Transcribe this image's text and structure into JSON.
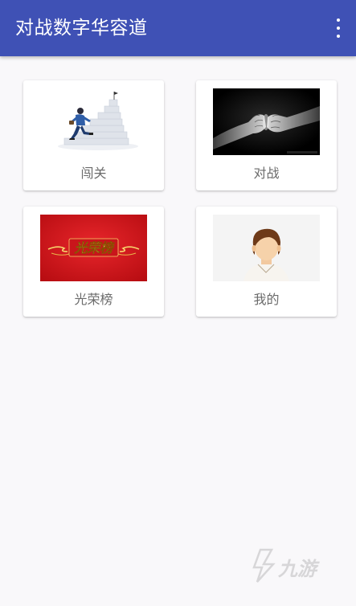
{
  "app_bar": {
    "title": "对战数字华容道",
    "menu_icon": "more-vert-icon",
    "background": "#3f51b5"
  },
  "menu": {
    "cards": [
      {
        "label": "闯关",
        "image": "businessman-climbing-stairs"
      },
      {
        "label": "对战",
        "image": "fist-bump"
      },
      {
        "label": "光荣榜",
        "image": "honor-roll-banner",
        "image_text": "光荣榜"
      },
      {
        "label": "我的",
        "image": "user-avatar"
      }
    ]
  },
  "watermark": {
    "text": "九游"
  },
  "colors": {
    "page_background": "#f9f8fa",
    "card_background": "#ffffff",
    "label_text": "#6b6b6b",
    "banner_red": "#d7141a",
    "banner_gold": "#f6d36b"
  }
}
